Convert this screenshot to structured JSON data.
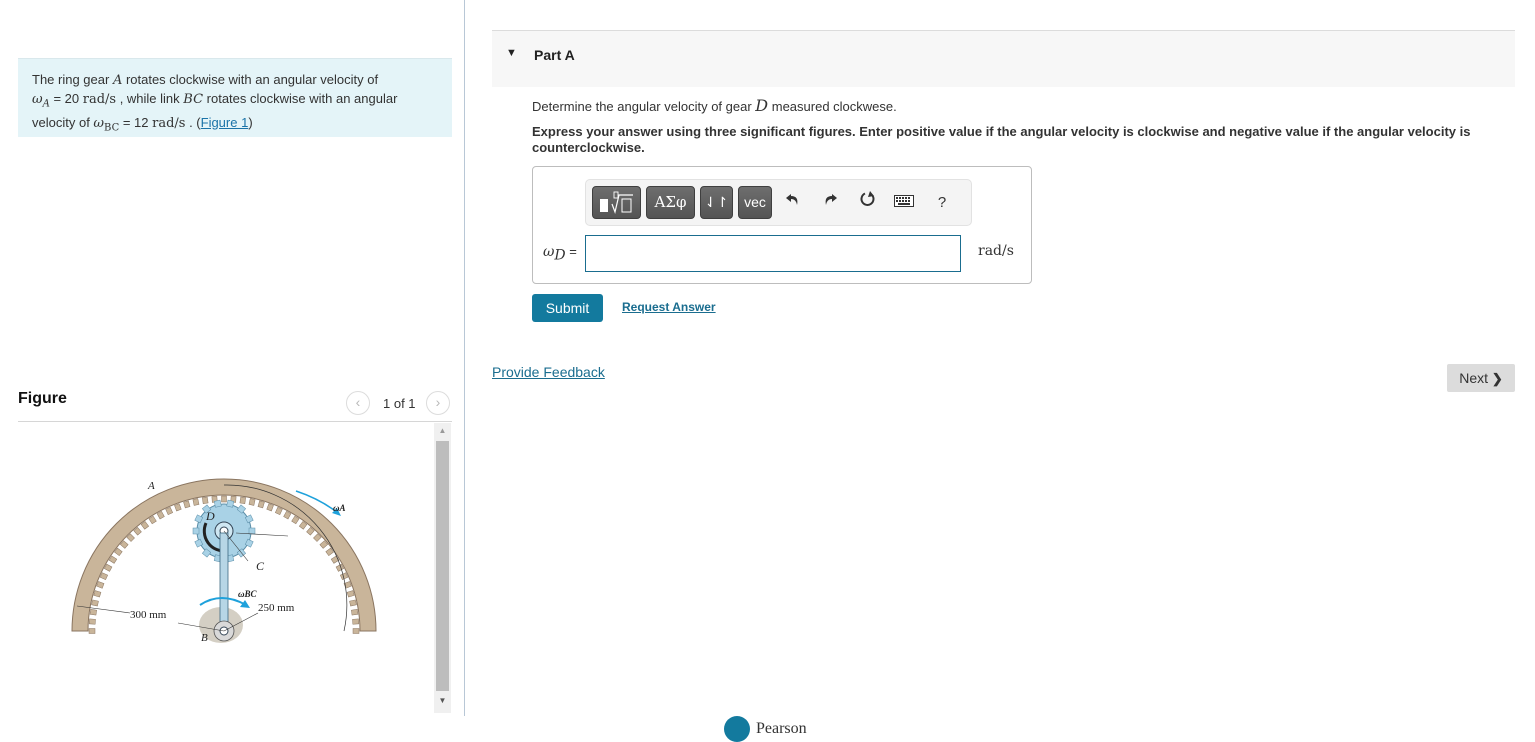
{
  "problem": {
    "line1_pre": "The ring gear ",
    "gear_a": "A",
    "line1_post": " rotates clockwise with an angular velocity of",
    "omega": "ω",
    "sub_a": "A",
    "value_a": " = 20 ",
    "unit": "rad/s",
    "line2_mid": " , while link ",
    "link_bc": "BC",
    "line2_post": " rotates clockwise with an angular",
    "line3_pre": "velocity of ",
    "sub_bc": "BC",
    "value_bc": " = 12 ",
    "line3_post": " . (",
    "figure_link": "Figure 1",
    "close_paren": ")"
  },
  "figure": {
    "title": "Figure",
    "pager_text": "1 of 1",
    "labels": {
      "ring_gear": "A",
      "gear": "D",
      "pin": "C",
      "pivot": "B",
      "omega_a": "ωA",
      "omega_bc": "ωBC",
      "radius_outer": "300 mm",
      "radius_inner": "250 mm"
    }
  },
  "part": {
    "title": "Part A",
    "question_pre": "Determine the angular velocity of gear ",
    "question_var": "D",
    "question_post": " measured clockwese.",
    "instructions": "Express your answer using three significant figures. Enter positive value if the angular velocity is clockwise and negative value if the angular velocity is counterclockwise."
  },
  "toolbar": {
    "greek_label": "ΑΣφ",
    "arrows_label": "⇃↾",
    "vec_label": "vec",
    "help_label": "?"
  },
  "answer": {
    "label_omega": "ω",
    "label_sub": "D",
    "label_eq": " =",
    "value": "",
    "placeholder": "",
    "unit": "rad/s"
  },
  "actions": {
    "submit": "Submit",
    "request_answer": "Request Answer",
    "provide_feedback": "Provide Feedback",
    "next": "Next"
  },
  "footer": {
    "brand": "Pearson"
  },
  "colors": {
    "accent": "#137a9e",
    "link": "#1a6d8f",
    "problem_bg": "#e4f4f8"
  }
}
